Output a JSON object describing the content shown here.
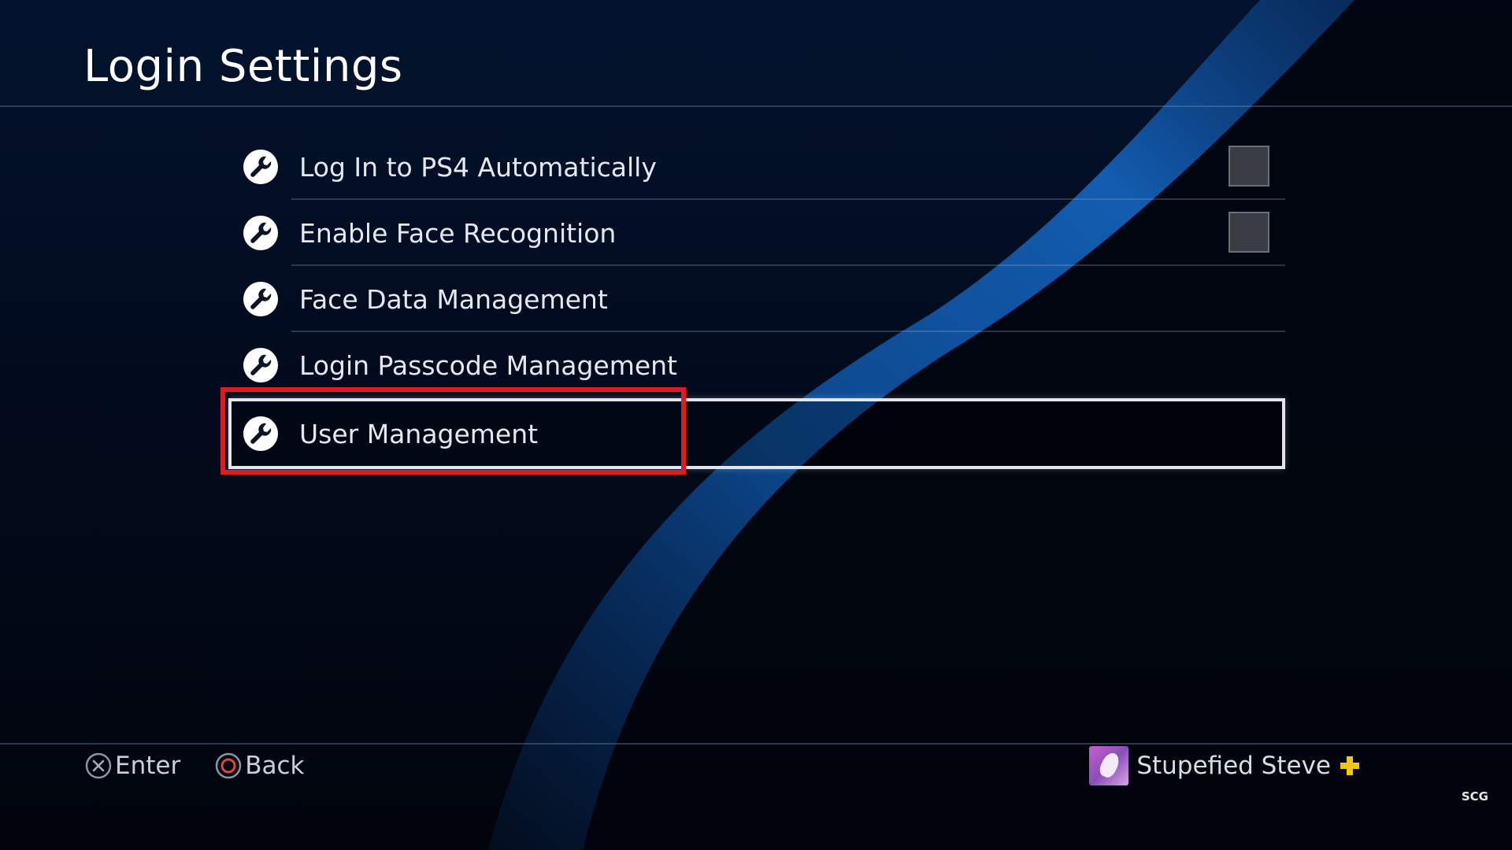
{
  "title": "Login Settings",
  "menu": {
    "items": [
      {
        "label": "Log In to PS4 Automatically",
        "icon": "wrench-icon",
        "has_checkbox": true,
        "checked": false
      },
      {
        "label": "Enable Face Recognition",
        "icon": "wrench-icon",
        "has_checkbox": true,
        "checked": false
      },
      {
        "label": "Face Data Management",
        "icon": "wrench-icon",
        "has_checkbox": false
      },
      {
        "label": "Login Passcode Management",
        "icon": "wrench-icon",
        "has_checkbox": false
      },
      {
        "label": "User Management",
        "icon": "wrench-icon",
        "has_checkbox": false,
        "selected": true
      }
    ]
  },
  "footer": {
    "enter_label": "Enter",
    "enter_icon": "cross-button-icon",
    "back_label": "Back",
    "back_icon": "circle-button-icon"
  },
  "user": {
    "name": "Stupefied Steve",
    "plus_icon": "ps-plus-icon"
  },
  "watermark": "SCG",
  "colors": {
    "highlight": "#e01922",
    "plus": "#f5c518",
    "selection_border": "#e2e6ec"
  }
}
